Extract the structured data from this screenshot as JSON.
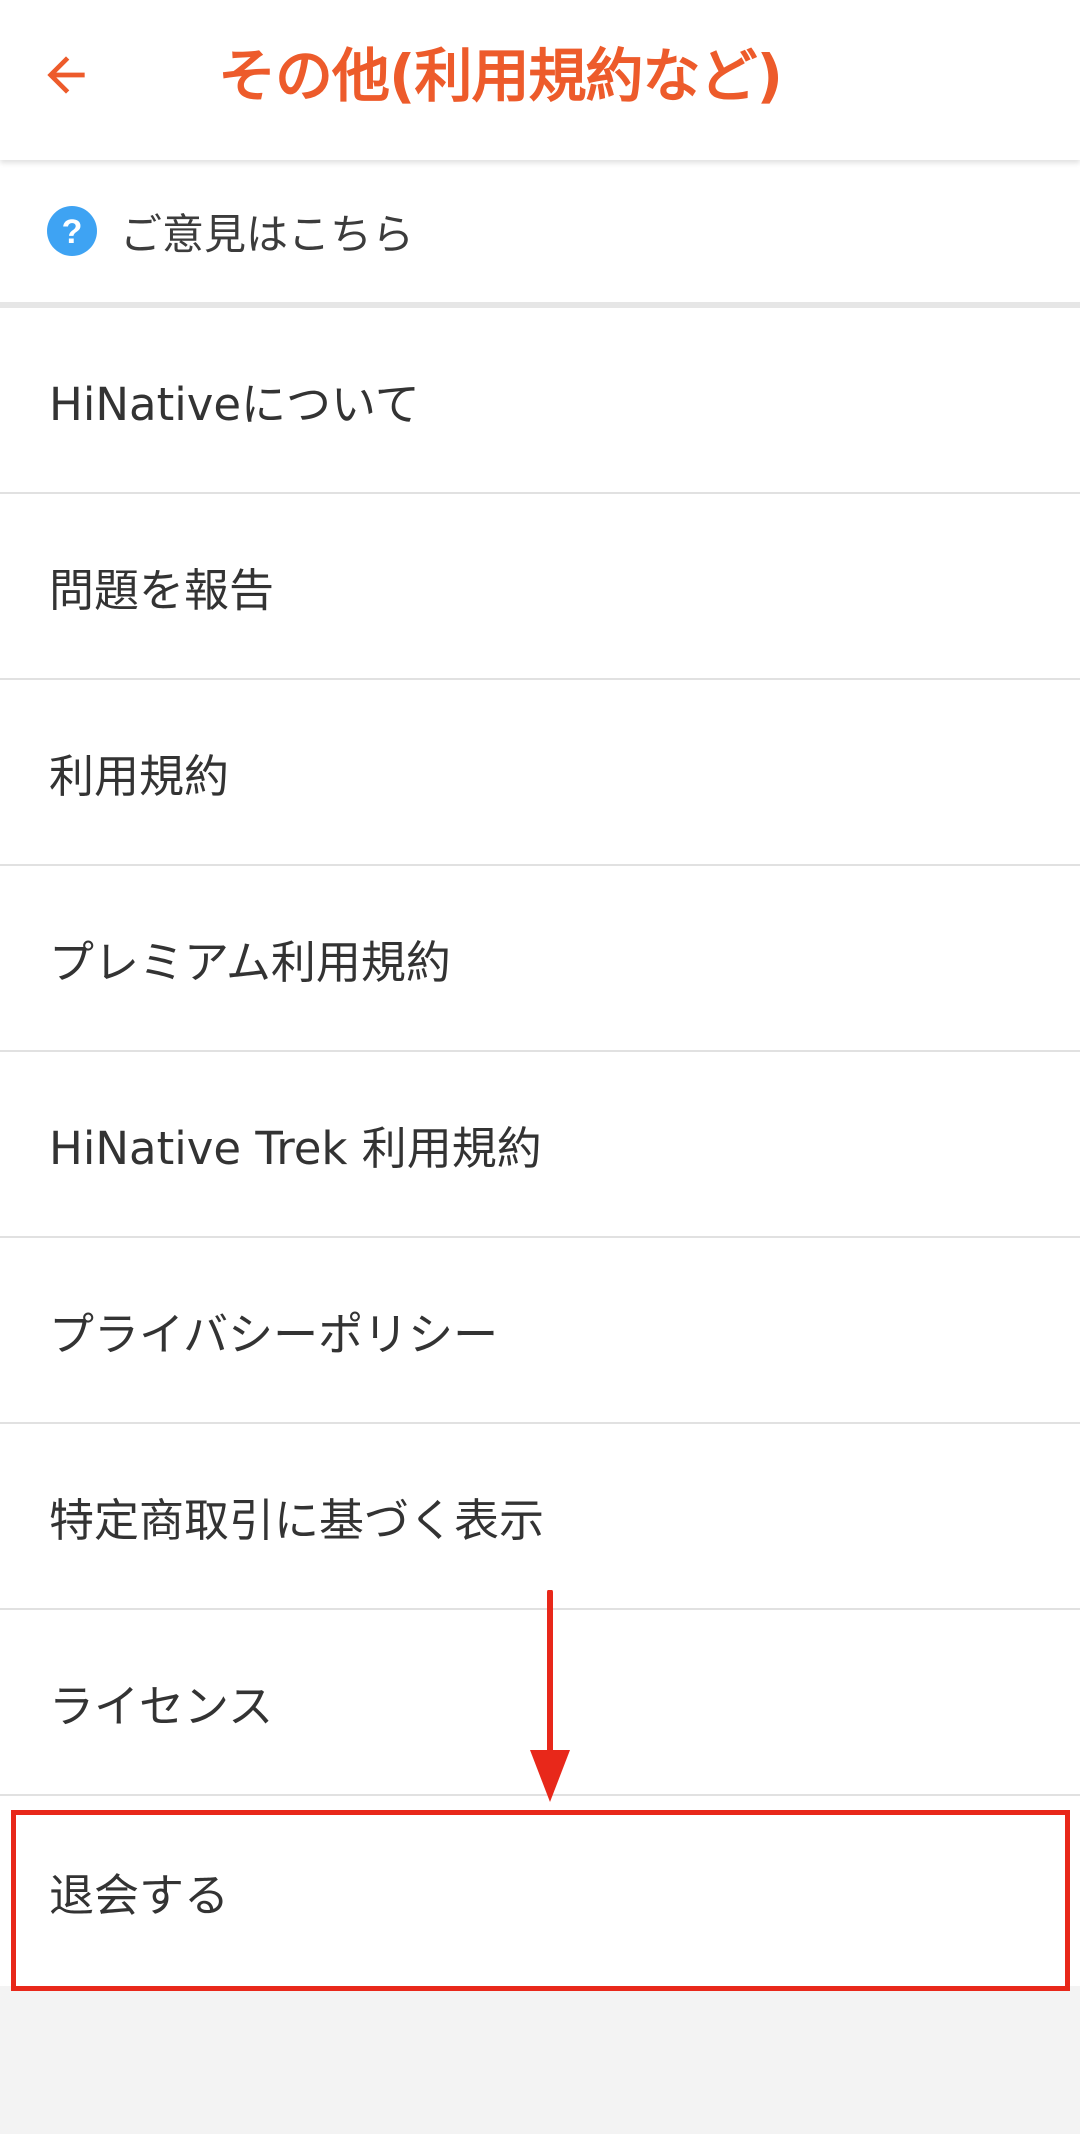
{
  "app_bar": {
    "title": "その他(利用規約など)",
    "back_icon": "arrow-back-icon",
    "accent_color": "#ed5b2b"
  },
  "feedback": {
    "icon": "help-circle-icon",
    "label": "ご意見はこちら",
    "icon_color": "#3ea3f3"
  },
  "menu": {
    "items": [
      {
        "label": "HiNativeについて"
      },
      {
        "label": "問題を報告"
      },
      {
        "label": "利用規約"
      },
      {
        "label": "プレミアム利用規約"
      },
      {
        "label": "HiNative Trek 利用規約"
      },
      {
        "label": "プライバシーポリシー"
      },
      {
        "label": "特定商取引に基づく表示"
      },
      {
        "label": "ライセンス"
      },
      {
        "label": "退会する"
      }
    ]
  },
  "annotation": {
    "highlight_color": "#e8281a",
    "arrow_icon": "arrow-down-icon",
    "highlighted_item": "退会する"
  }
}
